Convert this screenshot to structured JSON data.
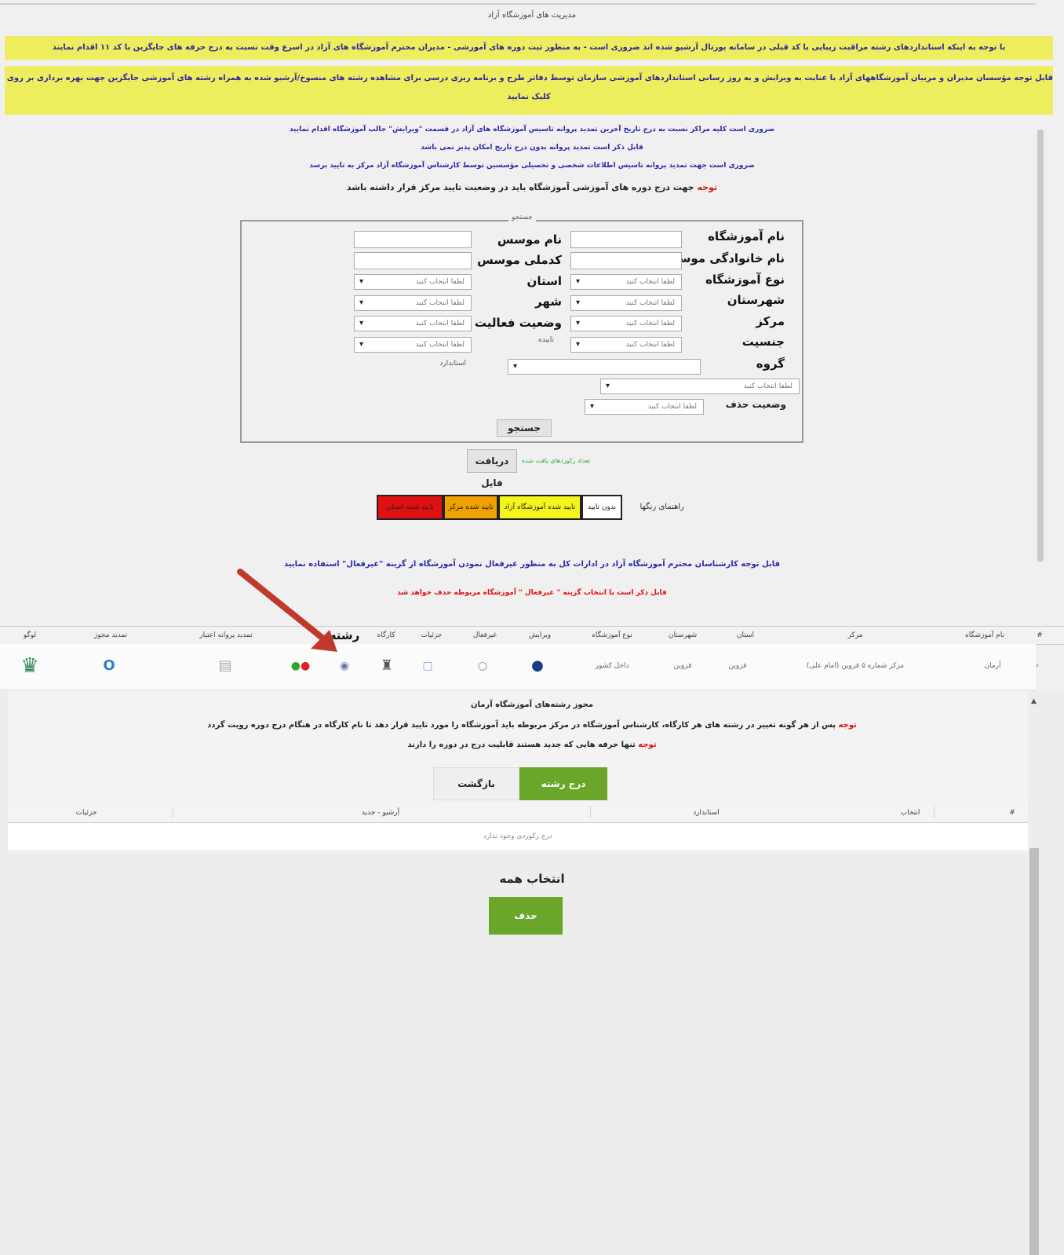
{
  "page": {
    "heading": "مدیریت های آموزشگاه آزاد",
    "notice_line_1": "با توجه به اینکه استانداردهای رشته مراقبت زیبایی با کد قبلی در سامانه پورتال آرشیو شده اند ضروری است - به منظور ثبت دوره های آموزشی - مدیران محترم آموزشگاه های آزاد در اسرع وقت نسبت به درج حرفه های جایگزین با کد ۱۱ اقدام نمایند",
    "notice_line_2a": "قابل توجه مؤسسان مدیران و مربیان آموزشگاههای آزاد با عنایت به ویرایش و به روز رسانی استانداردهای آموزشی سازمان توسط دفاتر طرح و برنامه ریزی درسی برای مشاهده رشته های منسوخ/آرشیو شده به همراه رشته های آموزشی جایگزین جهت بهره برداری بر روی این لینک",
    "notice_line_2b": "کلیک نمایید",
    "info_1": "ضروری است کلیه مراکز نسبت به درج تاریخ آخرین تمدید پروانه تاسیس آموزشگاه های آزاد در قسمت \"ویرایش\" جالب آموزشگاه اقدام نمایید",
    "info_2": "قابل ذکر است تمدید پروانه بدون درج تاریخ امکان پذیر نمی باشد",
    "info_3": "ضروری است جهت تمدید پروانه تاسیس اطلاعات شخصی و تحصیلی مؤسسین توسط کارشناس آموزشگاه آزاد مرکز به تایید برسد",
    "attention_word": "توجه",
    "attention_text": "جهت درج دوره های آموزشی آموزشگاه باید در وضعیت تایید مرکز قرار داشته باشد"
  },
  "search": {
    "legend": "جستجو",
    "labels": {
      "school_name": "نام آموزشگاه",
      "founder_family": "نام خانوادگی موسس",
      "school_type": "نوع آموزشگاه",
      "county": "شهرستان",
      "center": "مرکز",
      "gender": "جنسیت",
      "group": "گروه",
      "founder_name": "نام موسس",
      "founder_code": "کدملی موسس",
      "province": "استان",
      "city": "شهر",
      "activity_status": "وضعیت فعالیت",
      "delete_status": "وضعیت حذف"
    },
    "placeholder_select": "لطفا انتخاب کنید",
    "approval_label": "تاییده",
    "standard_label": "استاندارد",
    "search_button": "جستجو",
    "download_button": "دریافت فایل",
    "download_hint": "تعداد رکوردهای یافت شده"
  },
  "color_guide": {
    "label": "راهنمای رنگها",
    "items": [
      {
        "text": "بدون تایید",
        "color": "#ffffff"
      },
      {
        "text": "تایید شده آموزشگاه آزاد",
        "color": "#f5f51e"
      },
      {
        "text": "تایید شده مرکز",
        "color": "#f0a000"
      },
      {
        "text": "تایید شده استان",
        "color": "#e01010"
      }
    ]
  },
  "notes": {
    "note_blue": "قابل توجه کارشناسان محترم آموزشگاه آزاد در ادارات کل به منظور غیرفعال نمودن آموزشگاه از گزینه \"غیرفعال\" استفاده نمایید",
    "note_red": "قابل ذکر است با انتخاب گزینه \" غیرفعال \" آموزشگاه مربوطه حذف خواهد شد"
  },
  "table1": {
    "headers": [
      "#",
      "نام آموزشگاه",
      "مرکز",
      "استان",
      "شهرستان",
      "نوع آموزشگاه",
      "ویرایش",
      "غیرفعال",
      "جزئیات",
      "کارگاه",
      "رشته",
      "تمدید پروانه اعتبار",
      "تمدید مجوز",
      "لوگو"
    ],
    "row": {
      "name": "آرمان",
      "center": "مرکز شماره ۵ قزوین (امام علی)",
      "province": "قزوین",
      "county": "قزوین",
      "type": "داخل کشور"
    }
  },
  "lower": {
    "title": "مجوز رشته‌های آموزشگاه آرمان",
    "note1_word": "توجه",
    "note1_text": "پس از هر گونه تغییر در رشته های هر کارگاه، کارشناس آموزشگاه در مرکز مربوطه باید آموزشگاه را مورد تایید قرار دهد تا نام کارگاه در هنگام درج دوره رویت گردد",
    "note2_word": "توجه",
    "note2_text": "تنها حرفه هایی که جدید هستند قابلیت درج در دوره را دارند",
    "add_button": "درج رشته",
    "back_button": "بازگشت",
    "table_headers": [
      "#",
      "انتخاب",
      "استاندارد",
      "آرشیو - جدید",
      "جزئیات"
    ],
    "empty_text": "درج رکوردی وجود ندارد",
    "select_all": "انتخاب همه",
    "delete_button": "حذف"
  },
  "colors": {
    "band": "#eded5e",
    "green": "#6aa62a",
    "arrow": "#c0392b"
  }
}
